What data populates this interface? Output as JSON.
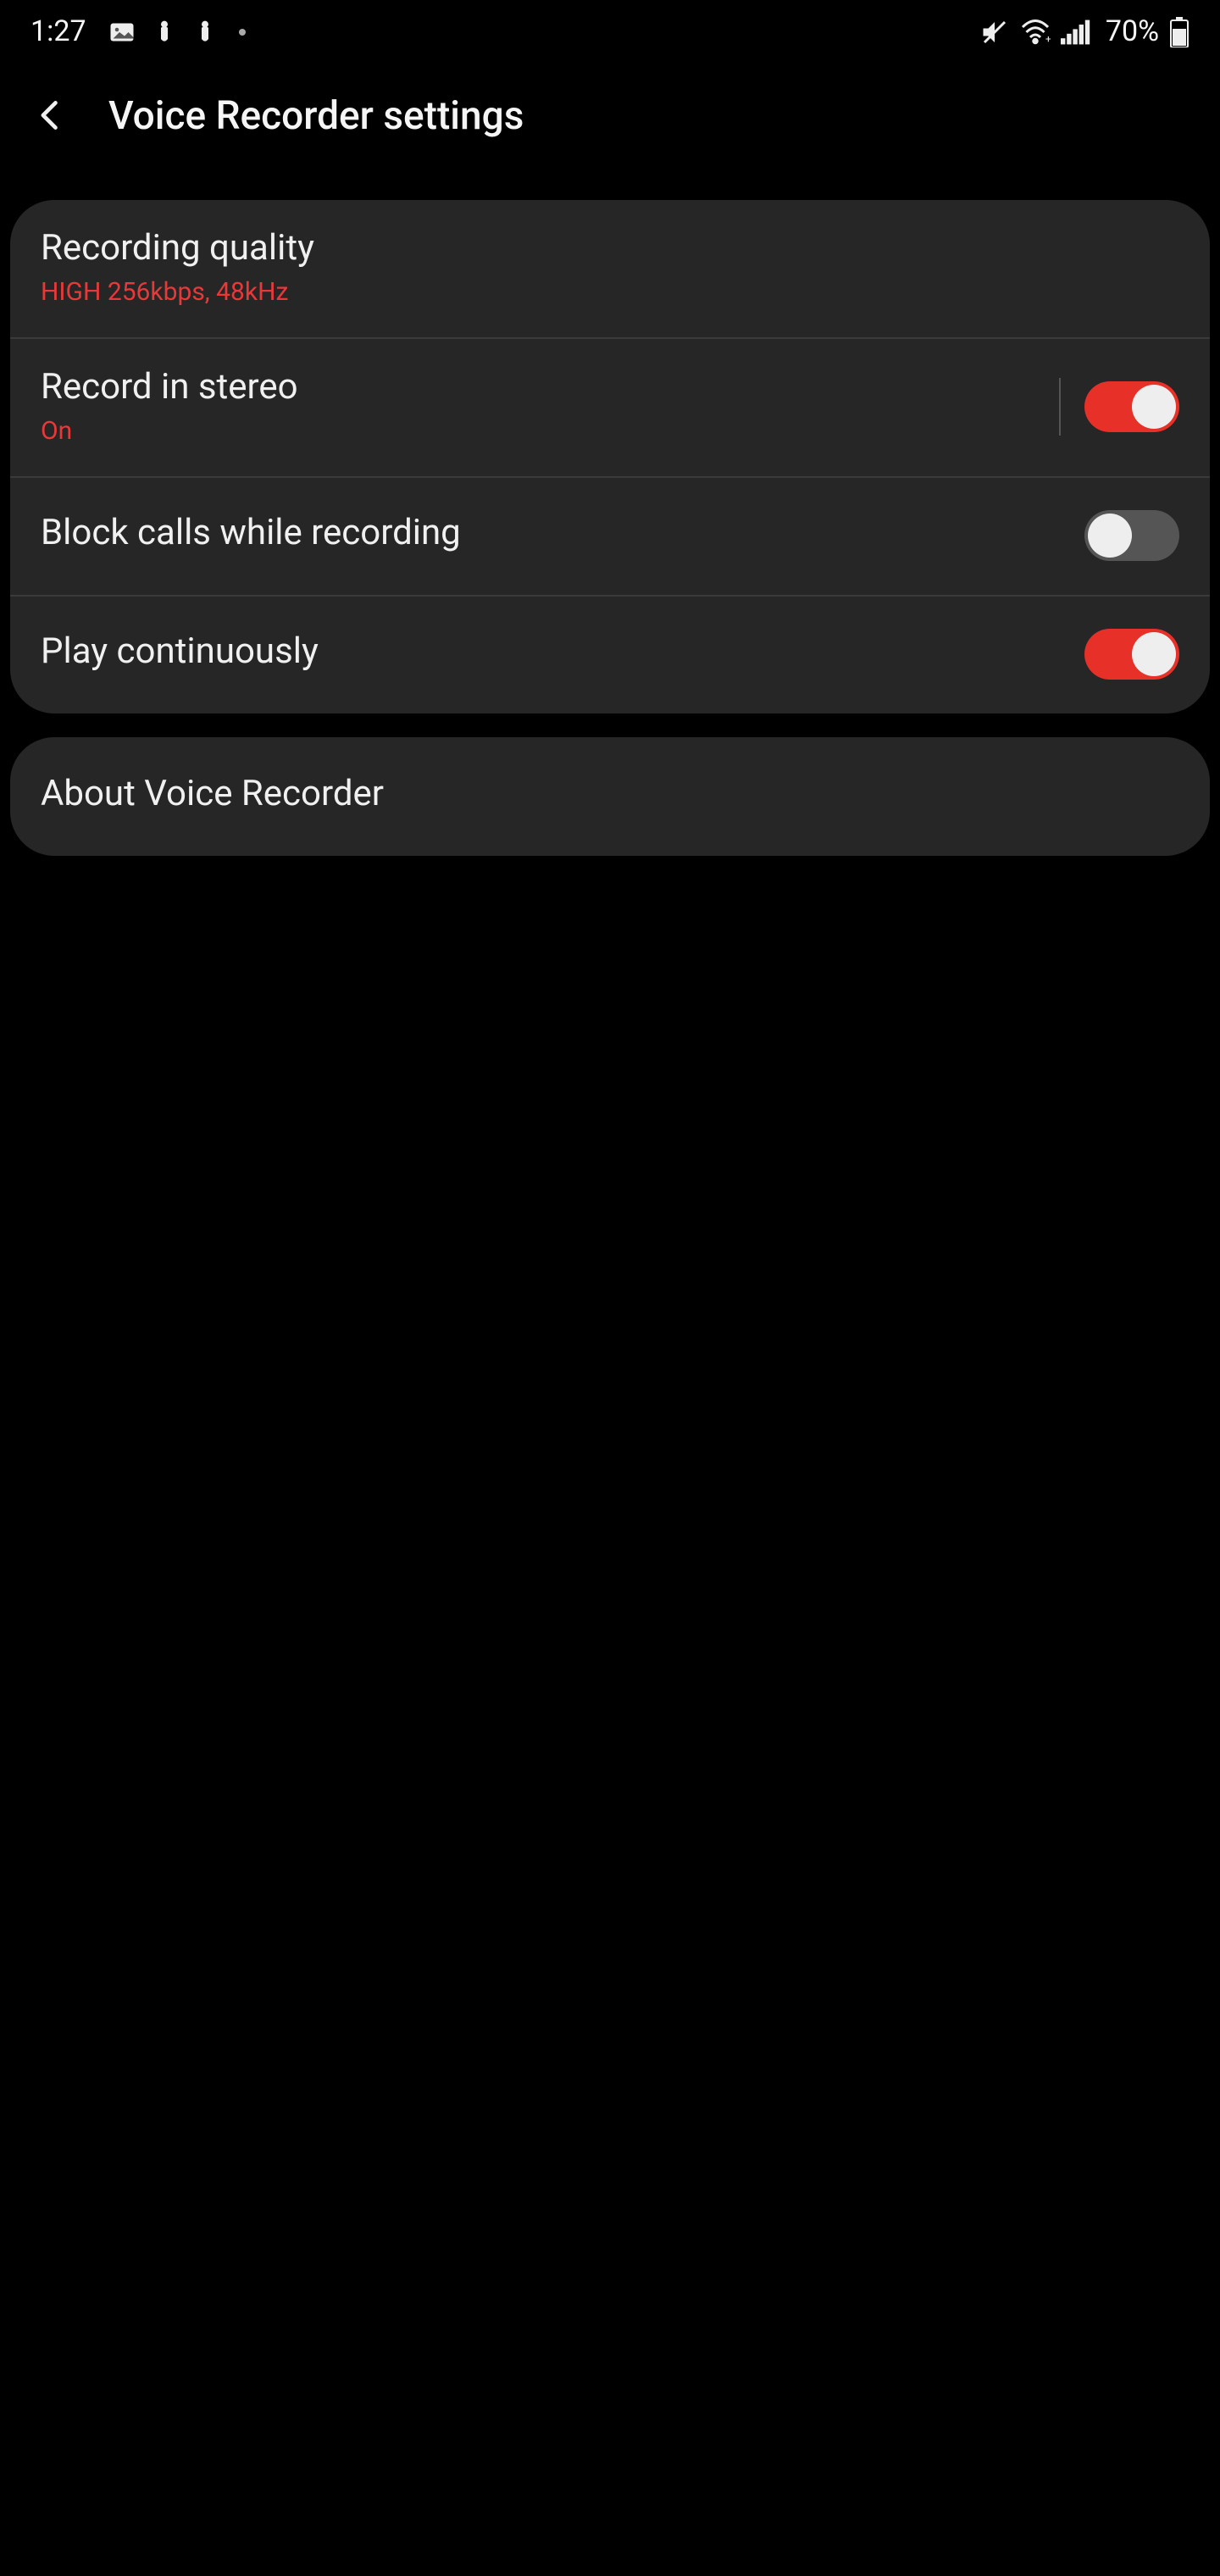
{
  "status": {
    "time": "1:27",
    "battery": "70%"
  },
  "header": {
    "title": "Voice Recorder settings"
  },
  "settings": {
    "quality": {
      "title": "Recording quality",
      "value": "HIGH 256kbps, 48kHz"
    },
    "stereo": {
      "title": "Record in stereo",
      "status": "On"
    },
    "block_calls": {
      "title": "Block calls while recording"
    },
    "play_cont": {
      "title": "Play continuously"
    }
  },
  "about": {
    "title": "About Voice Recorder"
  }
}
